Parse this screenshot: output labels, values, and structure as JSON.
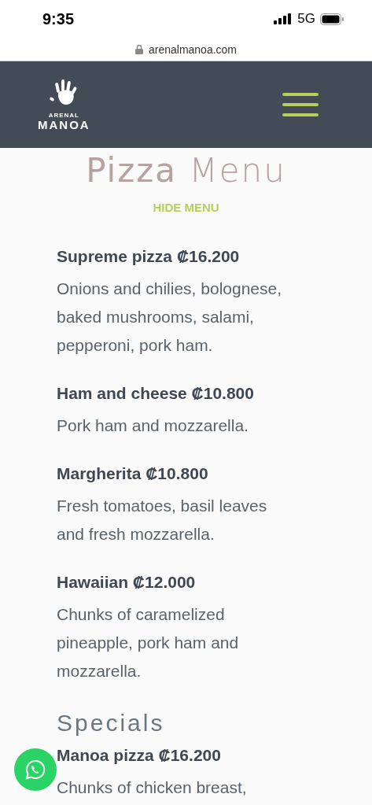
{
  "status_bar": {
    "time": "9:35",
    "network": "5G"
  },
  "browser": {
    "url": "arenalmanoa.com"
  },
  "header": {
    "logo_top": "ARENAL",
    "logo_name": "MANOA"
  },
  "title": "**Pizza** Menu",
  "toggle_link": "HIDE MENU",
  "items": [
    {
      "title": "Supreme pizza ₡16.200",
      "description": "Onions and chilies, bolognese, baked mushrooms, salami, pepperoni, pork ham."
    },
    {
      "title": "Ham and cheese ₡10.800",
      "description": "Pork ham and mozzarella."
    },
    {
      "title": "Margherita ₡10.800",
      "description": "Fresh tomatoes, basil leaves and fresh mozzarella."
    },
    {
      "title": "Hawaiian ₡12.000",
      "description": "Chunks of caramelized pineapple, pork ham and mozzarella."
    }
  ],
  "specials": {
    "heading": "Specials",
    "items": [
      {
        "title": "Manoa pizza ₡16.200",
        "description": "Chunks of chicken breast,"
      }
    ]
  }
}
